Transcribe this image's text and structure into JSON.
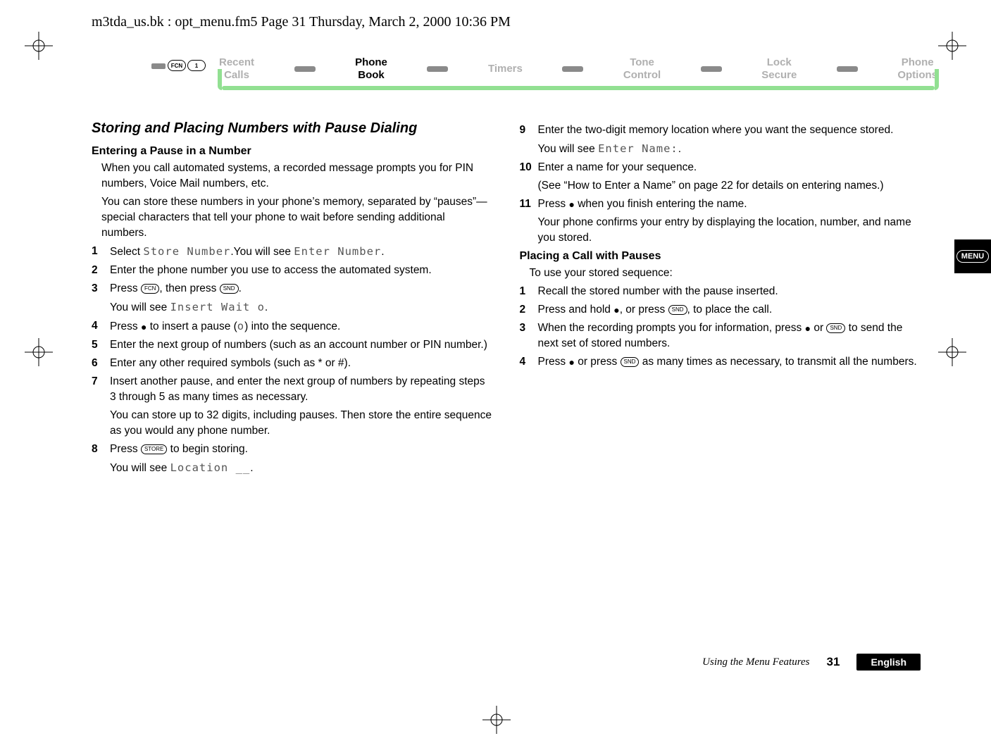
{
  "header_line": "m3tda_us.bk : opt_menu.fm5  Page 31  Thursday, March 2, 2000  10:36 PM",
  "nav": {
    "key1": "FCN",
    "key2": "1",
    "items": [
      {
        "l1": "Recent",
        "l2": "Calls",
        "active": false
      },
      {
        "l1": "Phone",
        "l2": "Book",
        "active": true
      },
      {
        "l1": "Timers",
        "l2": "",
        "active": false
      },
      {
        "l1": "Tone",
        "l2": "Control",
        "active": false
      },
      {
        "l1": "Lock",
        "l2": "Secure",
        "active": false
      },
      {
        "l1": "Phone",
        "l2": "Options",
        "active": false
      }
    ]
  },
  "left": {
    "section_title": "Storing and Placing Numbers with Pause Dialing",
    "sub_title": "Entering a Pause in a Number",
    "p1": "When you call automated systems, a recorded message prompts you for PIN numbers, Voice Mail numbers, etc.",
    "p2": "You can store these numbers in your phone’s memory, separated by “pauses”—special characters that tell your phone to wait before sending additional numbers.",
    "steps": {
      "s1a": "Select ",
      "s1_lcd1": "Store Number",
      "s1b": ".You will see ",
      "s1_lcd2": "Enter Number",
      "s1c": ".",
      "s2": "Enter the phone number you use to access the automated system.",
      "s3a": "Press ",
      "s3_key1": "FCN",
      "s3b": ", then press ",
      "s3_key2": "SND",
      "s3c": ".",
      "s3_sub_a": "You will see ",
      "s3_sub_lcd": "Insert Wait o",
      "s3_sub_b": ".",
      "s4a": "Press ",
      "s4b": " to insert a pause (",
      "s4c": ") into the sequence.",
      "s4_pause": "o",
      "s5": "Enter the next group of numbers (such as an account number or PIN number.)",
      "s6": "Enter any other required symbols (such as * or #).",
      "s7": "Insert another pause, and enter the next group of numbers by repeating steps 3 through 5 as many times as necessary.",
      "s7_sub": "You can store up to 32 digits, including pauses. Then store the entire sequence as you would any phone number.",
      "s8a": "Press ",
      "s8_key": "STORE",
      "s8b": " to begin storing.",
      "s8_sub_a": "You will see ",
      "s8_sub_lcd": "Location __",
      "s8_sub_b": "."
    }
  },
  "right": {
    "steps_cont": {
      "s9": "Enter the two-digit memory location where you want the sequence stored.",
      "s9_sub_a": "You will see ",
      "s9_sub_lcd": "Enter Name:",
      "s9_sub_b": ".",
      "s10": "Enter a name for your sequence.",
      "s10_sub": "(See “How to Enter a Name” on page 22 for details on entering names.)",
      "s11a": "Press ",
      "s11b": " when you finish entering the name.",
      "s11_sub": "Your phone confirms your entry by displaying the location, number, and name you stored."
    },
    "sub_title": "Placing a Call with Pauses",
    "p1": "To use your stored sequence:",
    "steps2": {
      "s1": "Recall the stored number with the pause inserted.",
      "s2a": "Press and hold ",
      "s2b": ", or press ",
      "s2_key": "SND",
      "s2c": ", to place the call.",
      "s3a": "When the recording prompts you for information, press ",
      "s3b": " or ",
      "s3_key": "SND",
      "s3c": " to send the next set of stored numbers.",
      "s4a": "Press ",
      "s4b": " or press ",
      "s4_key": "SND",
      "s4c": " as many times as necessary, to transmit all the numbers."
    }
  },
  "menu_tab": "MENU",
  "footer": {
    "doc_title": "Using the Menu Features",
    "page_num": "31",
    "lang": "English"
  }
}
